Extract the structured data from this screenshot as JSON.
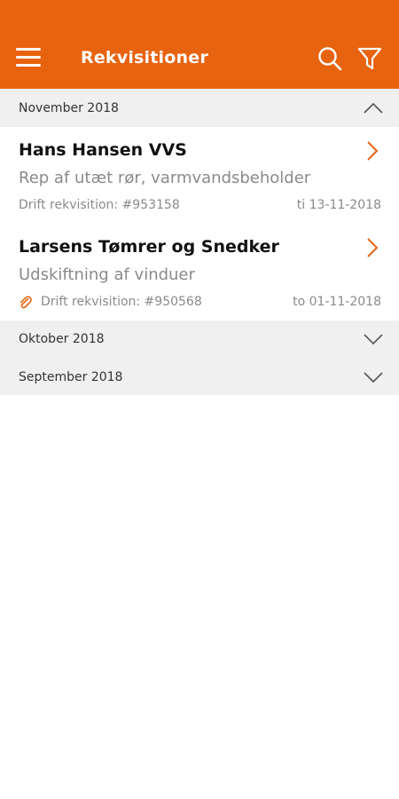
{
  "app": {
    "title": "Rekvisitioner",
    "accent_color": "#e8630f",
    "icons": {
      "menu": "hamburger-menu-icon",
      "search": "search-icon",
      "filter": "filter-funnel-icon"
    }
  },
  "sections": [
    {
      "label": "November 2018",
      "expanded": true,
      "items": [
        {
          "name": "Hans Hansen VVS",
          "description": "Rep af utæt rør, varmvandsbeholder",
          "reference": "Drift rekvisition: #953158",
          "date": "ti 13-11-2018",
          "has_attachment": false
        },
        {
          "name": "Larsens Tømrer og Snedker",
          "description": "Udskiftning af vinduer",
          "reference": "Drift rekvisition: #950568",
          "date": "to 01-11-2018",
          "has_attachment": true
        }
      ]
    },
    {
      "label": "Oktober 2018",
      "expanded": false,
      "items": []
    },
    {
      "label": "September 2018",
      "expanded": false,
      "items": []
    }
  ]
}
